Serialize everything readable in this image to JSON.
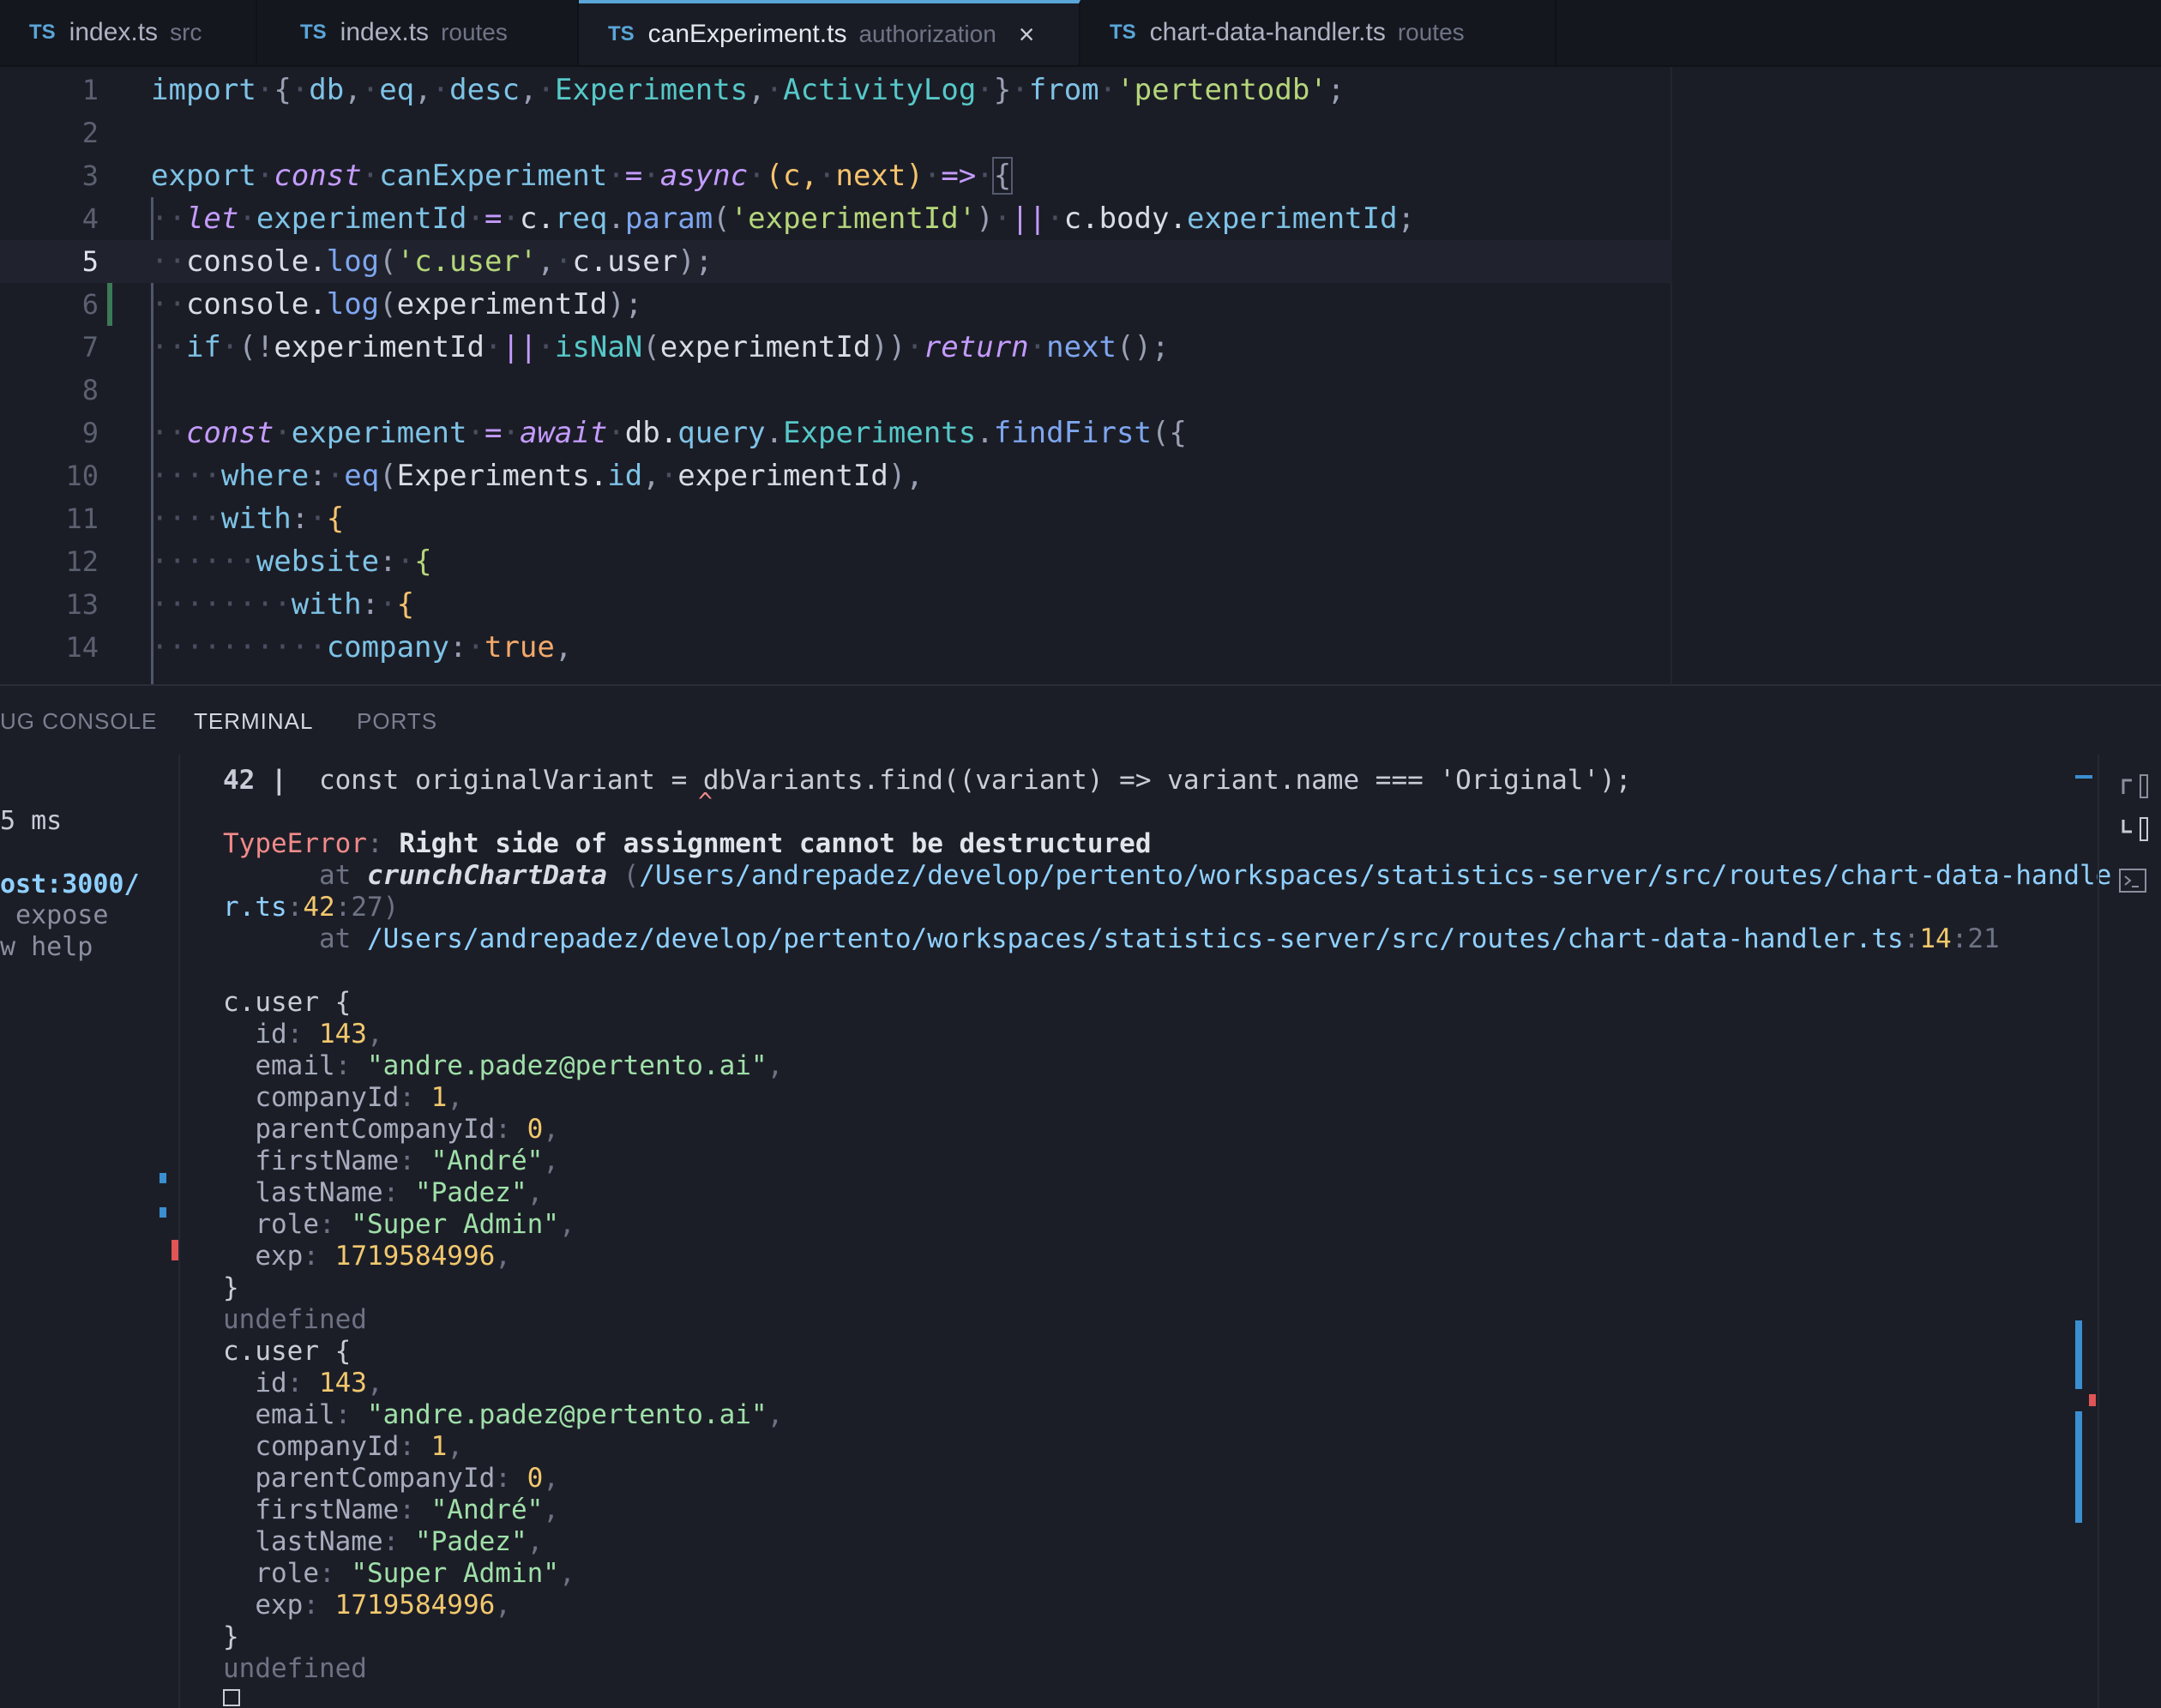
{
  "tabs": [
    {
      "name": "index.ts",
      "dir": "src",
      "active": false
    },
    {
      "name": "index.ts",
      "dir": "routes",
      "active": false
    },
    {
      "name": "canExperiment.ts",
      "dir": "authorization",
      "active": true,
      "close": "×"
    },
    {
      "name": "chart-data-handler.ts",
      "dir": "routes",
      "active": false
    }
  ],
  "tab_lang": "TS",
  "editor": {
    "active_line": 5,
    "line_numbers": [
      "1",
      "2",
      "3",
      "4",
      "5",
      "6",
      "7",
      "8",
      "9",
      "10",
      "11",
      "12",
      "13",
      "14"
    ]
  },
  "panel": {
    "tabs": [
      "UG CONSOLE",
      "TERMINAL",
      "PORTS"
    ],
    "active_tab": "TERMINAL",
    "left_lines": [
      "5 ms",
      "ost:3000/",
      " expose",
      "w help"
    ]
  },
  "terminal": {
    "src_line_no": "42 |",
    "src_line": "const originalVariant = dbVariants.find((variant) => variant.name === 'Original');",
    "caret": "^",
    "error_type": "TypeError",
    "error_msg": "Right side of assignment cannot be destructured",
    "at": "at",
    "stack1_fn": "crunchChartData",
    "stack1_path": "/Users/andrepadez/develop/pertento/workspaces/statistics-server/src/routes/chart-data-handle",
    "stack1_cont": "r.ts",
    "stack1_line": "42",
    "stack1_col": "27",
    "stack2_path": "/Users/andrepadez/develop/pertento/workspaces/statistics-server/src/routes/chart-data-handler.ts",
    "stack2_line": "14",
    "stack2_col": "21",
    "user_label": "c.user {",
    "user": {
      "id": "143",
      "email": "\"andre.padez@pertento.ai\"",
      "companyId": "1",
      "parentCompanyId": "0",
      "firstName": "\"André\"",
      "lastName": "\"Padez\"",
      "role": "\"Super Admin\"",
      "exp": "1719584996"
    },
    "close_brace": "}",
    "undefined": "undefined"
  },
  "colors": {
    "accent": "#5aa6d8",
    "error": "#f08a8a",
    "background": "#1b1d26"
  }
}
